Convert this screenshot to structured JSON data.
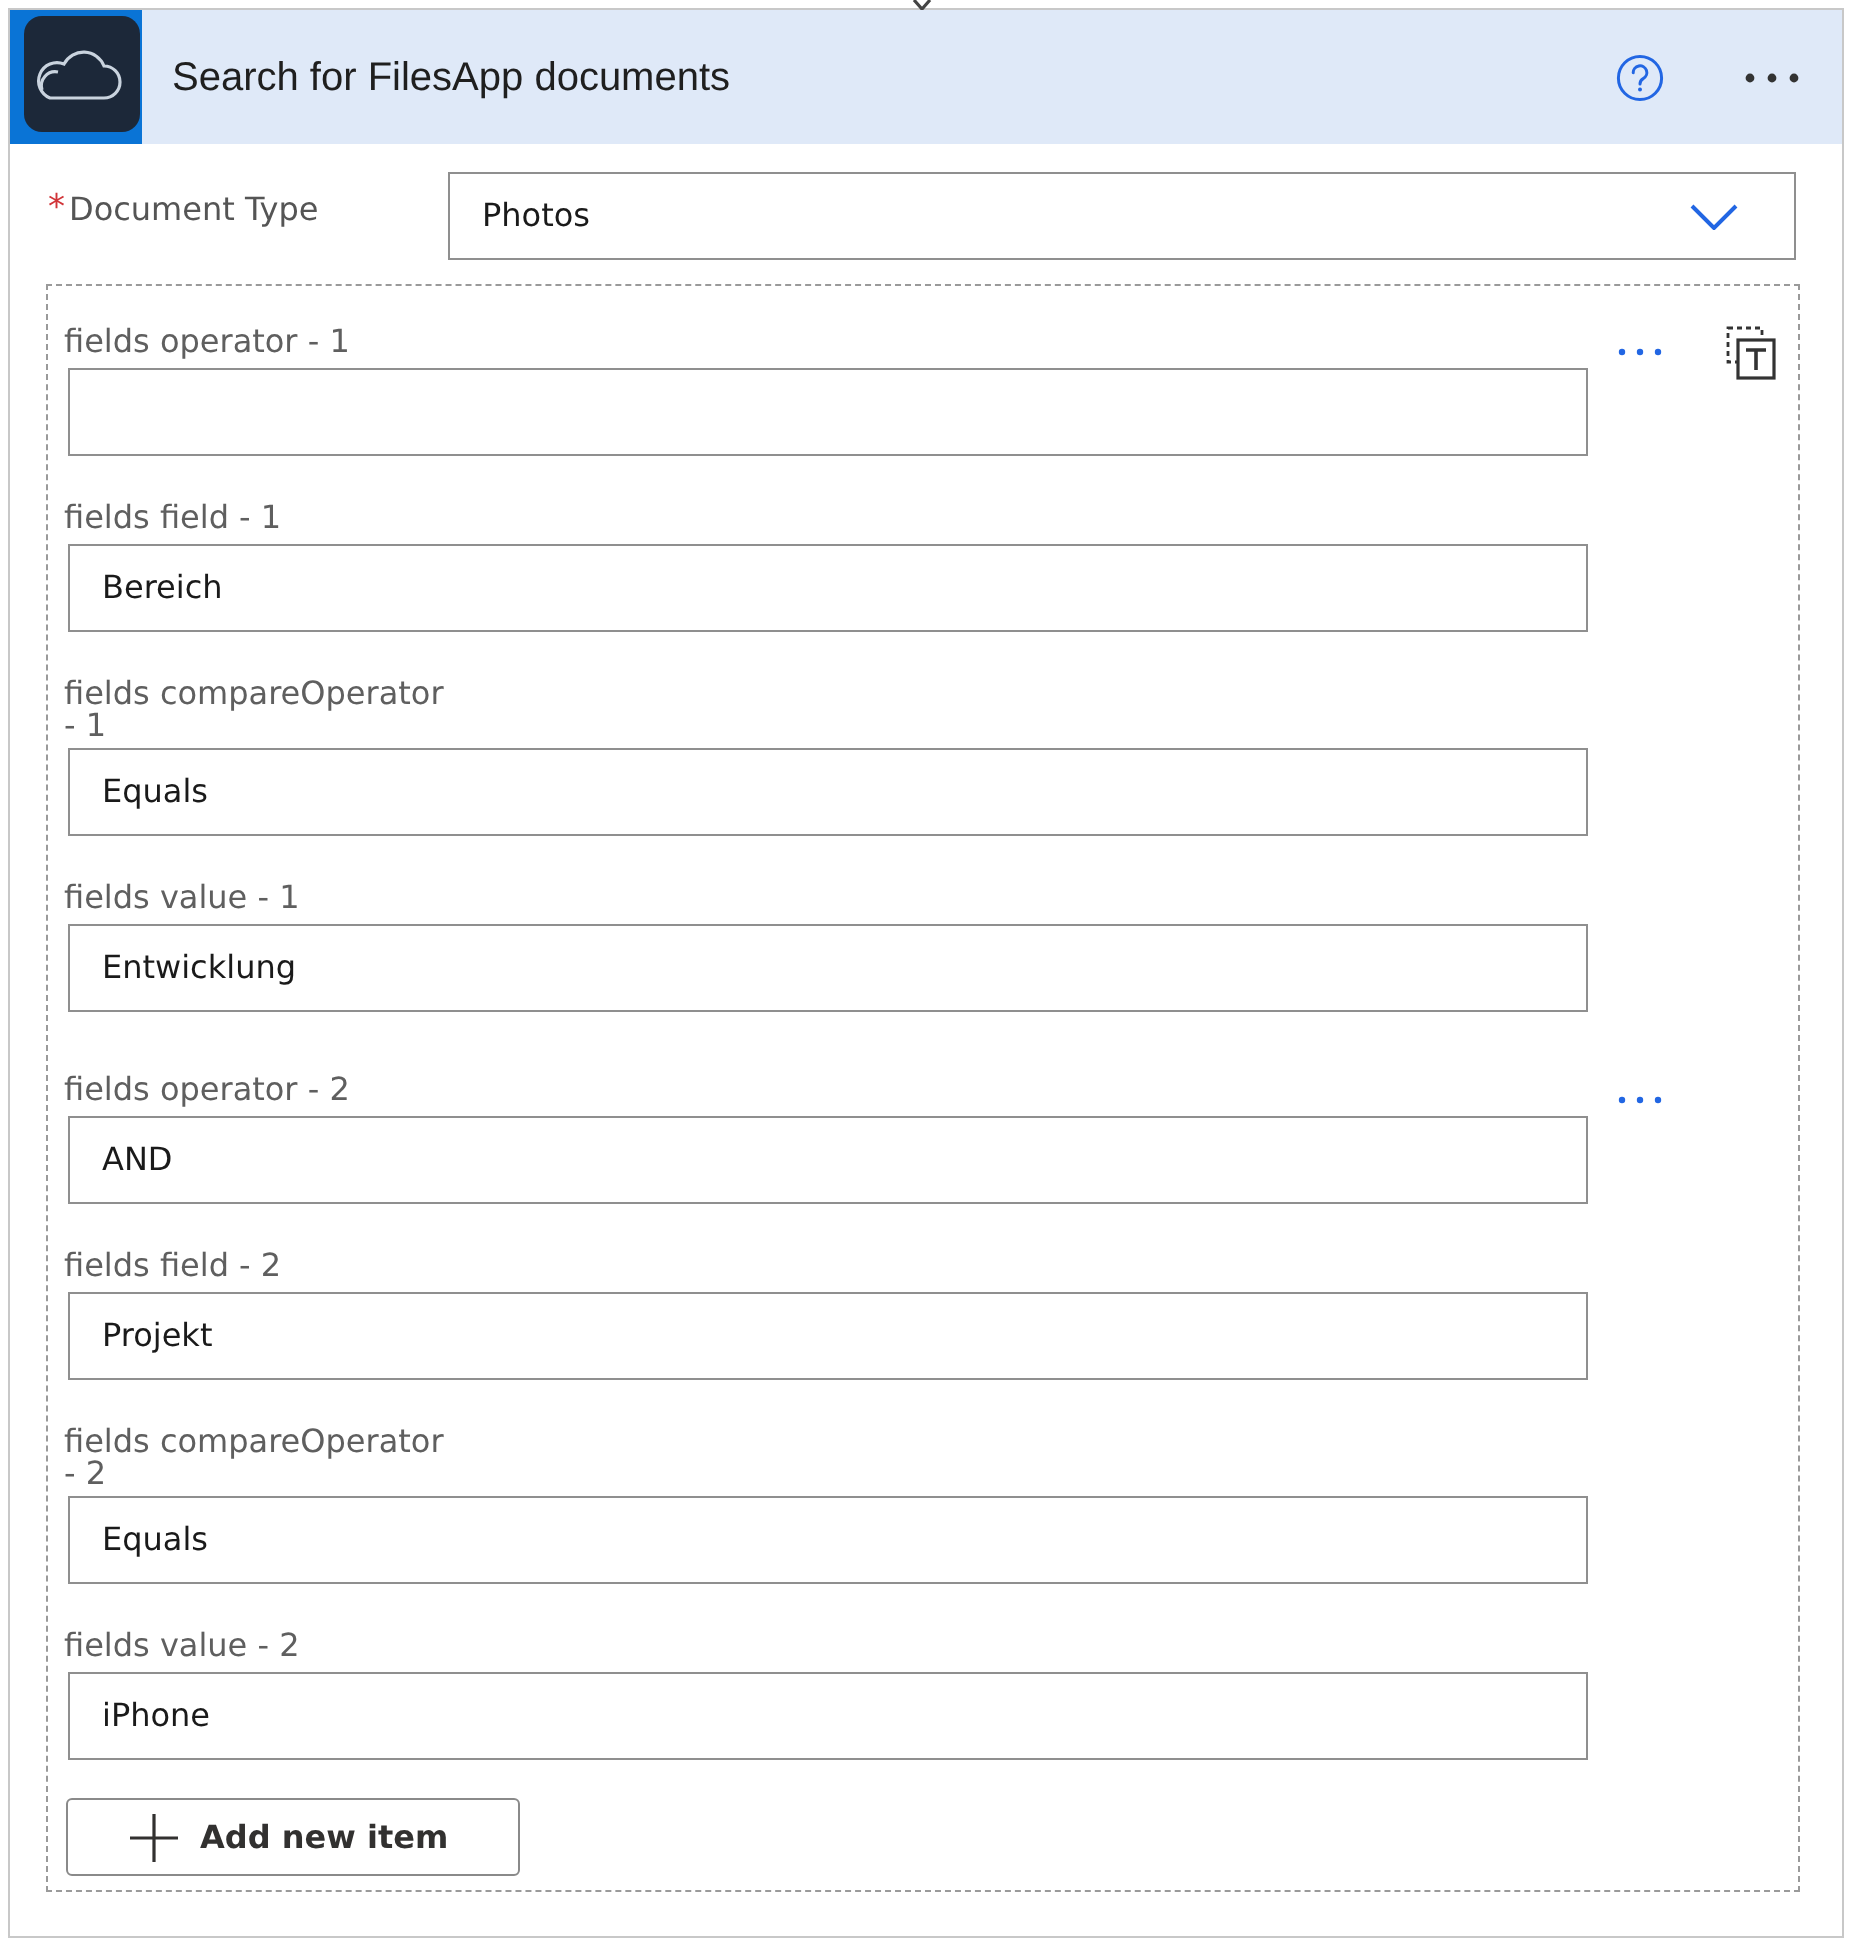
{
  "card": {
    "title": "Search for FilesApp documents"
  },
  "document_type": {
    "required_mark": "*",
    "label": "Document Type",
    "value": "Photos"
  },
  "items": [
    {
      "fields": [
        {
          "label": "fields operator - 1"
        },
        {
          "label": "fields field - 1",
          "value": "Bereich"
        },
        {
          "label": "fields compareOperator - 1",
          "value": "Equals"
        },
        {
          "label": "fields value - 1",
          "value": "Entwicklung"
        }
      ]
    },
    {
      "fields": [
        {
          "label": "fields operator - 2",
          "value": "AND"
        },
        {
          "label": "fields field - 2",
          "value": "Projekt"
        },
        {
          "label": "fields compareOperator - 2",
          "value": "Equals"
        },
        {
          "label": "fields value - 2",
          "value": "iPhone"
        }
      ]
    }
  ],
  "add_button": {
    "label": "Add new item"
  }
}
